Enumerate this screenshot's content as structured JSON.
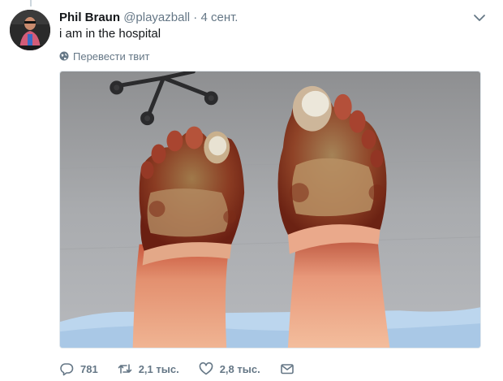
{
  "tweet": {
    "author_name": "Phil Braun",
    "author_handle": "@playazball",
    "separator": "·",
    "timestamp": "4 сент.",
    "text": "i am in the hospital",
    "translate_label": "Перевести твит"
  },
  "actions": {
    "reply_count": "781",
    "retweet_count": "2,1 тыс.",
    "like_count": "2,8 тыс."
  },
  "icons": {
    "caret": "chevron-down-icon",
    "translate": "globe-icon",
    "reply": "reply-icon",
    "retweet": "retweet-icon",
    "like": "heart-icon",
    "message": "envelope-icon"
  },
  "colors": {
    "text_primary": "#14171a",
    "text_secondary": "#657786",
    "border": "#e1e8ed"
  }
}
